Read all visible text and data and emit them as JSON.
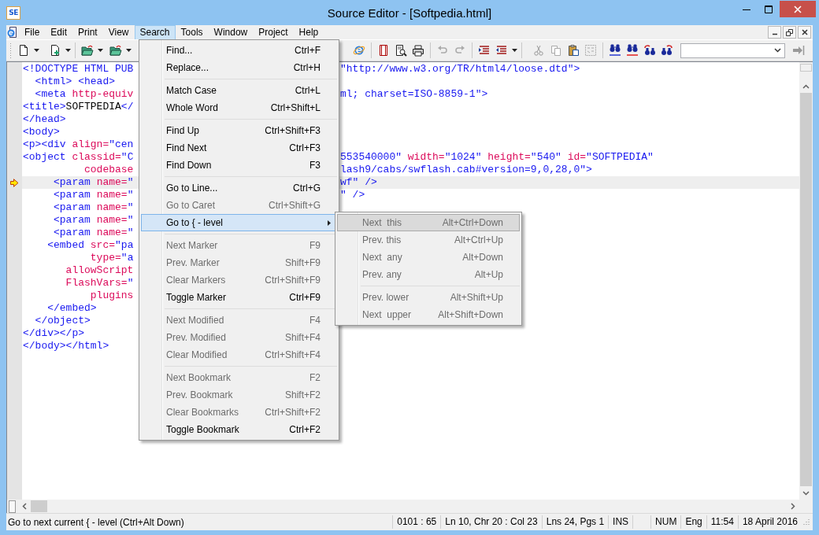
{
  "window": {
    "title": "Source Editor - [Softpedia.html]",
    "app_badge": "SE"
  },
  "menubar": [
    {
      "label": "File",
      "selected": false
    },
    {
      "label": "Edit",
      "selected": false
    },
    {
      "label": "Print",
      "selected": false
    },
    {
      "label": "View",
      "selected": false
    },
    {
      "label": "Search",
      "selected": true
    },
    {
      "label": "Tools",
      "selected": false
    },
    {
      "label": "Window",
      "selected": false
    },
    {
      "label": "Project",
      "selected": false
    },
    {
      "label": "Help",
      "selected": false
    }
  ],
  "editor": {
    "lines": [
      {
        "current": false,
        "marker": false,
        "left": [
          {
            "kind": "tag",
            "text": "<!DOCTYPE HTML PUB"
          }
        ],
        "right": [
          {
            "kind": "tag",
            "text": "\"http://www.w3.org/TR/html4/loose.dtd\">"
          }
        ]
      },
      {
        "current": false,
        "marker": false,
        "left": [
          {
            "kind": "tag",
            "text": "  <html> <head>"
          }
        ]
      },
      {
        "current": false,
        "marker": false,
        "left": [
          {
            "kind": "tag",
            "text": "  <meta"
          },
          {
            "kind": "attr",
            "text": " http-equiv"
          }
        ],
        "right": [
          {
            "kind": "tag",
            "text": "ml; charset=ISO-8859-1\">"
          }
        ]
      },
      {
        "current": false,
        "marker": false,
        "left": [
          {
            "kind": "tag",
            "text": "<title>"
          },
          {
            "kind": "text",
            "text": "SOFTPEDIA"
          },
          {
            "kind": "tag",
            "text": "</"
          }
        ]
      },
      {
        "current": false,
        "marker": false,
        "left": [
          {
            "kind": "tag",
            "text": "</head>"
          }
        ]
      },
      {
        "current": false,
        "marker": false,
        "left": [
          {
            "kind": "tag",
            "text": "<body>"
          }
        ]
      },
      {
        "current": false,
        "marker": false,
        "left": [
          {
            "kind": "tag",
            "text": "<p><div"
          },
          {
            "kind": "attr",
            "text": " align="
          },
          {
            "kind": "tag",
            "text": "\"cen"
          }
        ]
      },
      {
        "current": false,
        "marker": false,
        "left": [
          {
            "kind": "tag",
            "text": "<object"
          },
          {
            "kind": "attr",
            "text": " classid="
          },
          {
            "kind": "tag",
            "text": "\"C"
          }
        ],
        "right": [
          {
            "kind": "tag",
            "text": "553540000\""
          },
          {
            "kind": "attr",
            "text": " width="
          },
          {
            "kind": "tag",
            "text": "\"1024\""
          },
          {
            "kind": "attr",
            "text": " height="
          },
          {
            "kind": "tag",
            "text": "\"540\""
          },
          {
            "kind": "attr",
            "text": " id="
          },
          {
            "kind": "tag",
            "text": "\"SOFTPEDIA\""
          }
        ]
      },
      {
        "current": false,
        "marker": false,
        "left": [
          {
            "kind": "attr",
            "text": "          codebase"
          }
        ],
        "right": [
          {
            "kind": "tag",
            "text": "lash9/cabs/swflash.cab#version=9,0,28,0\">"
          }
        ]
      },
      {
        "current": true,
        "marker": true,
        "left": [
          {
            "kind": "tag",
            "text": "     <param"
          },
          {
            "kind": "attr",
            "text": " name="
          },
          {
            "kind": "tag",
            "text": "\""
          }
        ],
        "right": [
          {
            "kind": "tag",
            "text": "wf\" />"
          }
        ]
      },
      {
        "current": false,
        "marker": false,
        "left": [
          {
            "kind": "tag",
            "text": "     <param"
          },
          {
            "kind": "attr",
            "text": " name="
          },
          {
            "kind": "tag",
            "text": "\""
          }
        ],
        "right": [
          {
            "kind": "tag",
            "text": "\" />"
          }
        ]
      },
      {
        "current": false,
        "marker": false,
        "left": [
          {
            "kind": "tag",
            "text": "     <param"
          },
          {
            "kind": "attr",
            "text": " name="
          },
          {
            "kind": "tag",
            "text": "\""
          }
        ]
      },
      {
        "current": false,
        "marker": false,
        "left": [
          {
            "kind": "tag",
            "text": "     <param"
          },
          {
            "kind": "attr",
            "text": " name="
          },
          {
            "kind": "tag",
            "text": "\""
          }
        ]
      },
      {
        "current": false,
        "marker": false,
        "left": [
          {
            "kind": "tag",
            "text": "     <param"
          },
          {
            "kind": "attr",
            "text": " name="
          },
          {
            "kind": "tag",
            "text": "\""
          }
        ]
      },
      {
        "current": false,
        "marker": false,
        "left": [
          {
            "kind": "tag",
            "text": "    <embed"
          },
          {
            "kind": "attr",
            "text": " src="
          },
          {
            "kind": "tag",
            "text": "\"pa"
          }
        ]
      },
      {
        "current": false,
        "marker": false,
        "left": [
          {
            "kind": "attr",
            "text": "           type="
          },
          {
            "kind": "tag",
            "text": "\"a"
          }
        ]
      },
      {
        "current": false,
        "marker": false,
        "left": [
          {
            "kind": "attr",
            "text": "       allowScript"
          }
        ]
      },
      {
        "current": false,
        "marker": false,
        "left": [
          {
            "kind": "attr",
            "text": "       FlashVars="
          },
          {
            "kind": "tag",
            "text": "\""
          }
        ]
      },
      {
        "current": false,
        "marker": false,
        "left": [
          {
            "kind": "attr",
            "text": "           plugins"
          }
        ]
      },
      {
        "current": false,
        "marker": false,
        "left": [
          {
            "kind": "tag",
            "text": "    </embed>"
          }
        ]
      },
      {
        "current": false,
        "marker": false,
        "left": [
          {
            "kind": "tag",
            "text": "  </object>"
          }
        ]
      },
      {
        "current": false,
        "marker": false,
        "left": [
          {
            "kind": "tag",
            "text": "</div></p>"
          }
        ]
      },
      {
        "current": false,
        "marker": false,
        "left": [
          {
            "kind": "tag",
            "text": "</body></html>"
          }
        ]
      }
    ]
  },
  "search_menu": {
    "groups": [
      [
        {
          "label": "Find...",
          "shortcut": "Ctrl+F",
          "disabled": false,
          "selected": false
        },
        {
          "label": "Replace...",
          "shortcut": "Ctrl+H",
          "disabled": false,
          "selected": false
        }
      ],
      [
        {
          "label": "Match Case",
          "shortcut": "Ctrl+L",
          "disabled": false,
          "selected": false
        },
        {
          "label": "Whole Word",
          "shortcut": "Ctrl+Shift+L",
          "disabled": false,
          "selected": false
        }
      ],
      [
        {
          "label": "Find Up",
          "shortcut": "Ctrl+Shift+F3",
          "disabled": false,
          "selected": false
        },
        {
          "label": "Find Next",
          "shortcut": "Ctrl+F3",
          "disabled": false,
          "selected": false
        },
        {
          "label": "Find Down",
          "shortcut": "F3",
          "disabled": false,
          "selected": false
        }
      ],
      [
        {
          "label": "Go to Line...",
          "shortcut": "Ctrl+G",
          "disabled": false,
          "selected": false
        },
        {
          "label": "Go to Caret",
          "shortcut": "Ctrl+Shift+G",
          "disabled": true,
          "selected": false
        },
        {
          "label": "Go to { - level",
          "disabled": false,
          "selected": true,
          "submenu": {
            "groups": [
              [
                {
                  "label": "Next  this",
                  "shortcut": "Alt+Ctrl+Down",
                  "disabled": true,
                  "selected": true
                },
                {
                  "label": "Prev. this",
                  "shortcut": "Alt+Ctrl+Up",
                  "disabled": true,
                  "selected": false
                },
                {
                  "label": "Next  any",
                  "shortcut": "Alt+Down",
                  "disabled": true,
                  "selected": false
                },
                {
                  "label": "Prev. any",
                  "shortcut": "Alt+Up",
                  "disabled": true,
                  "selected": false
                }
              ],
              [
                {
                  "label": "Prev. lower",
                  "shortcut": "Alt+Shift+Up",
                  "disabled": true,
                  "selected": false
                },
                {
                  "label": "Next  upper",
                  "shortcut": "Alt+Shift+Down",
                  "disabled": true,
                  "selected": false
                }
              ]
            ]
          }
        }
      ],
      [
        {
          "label": "Next Marker",
          "shortcut": "F9",
          "disabled": true,
          "selected": false
        },
        {
          "label": "Prev. Marker",
          "shortcut": "Shift+F9",
          "disabled": true,
          "selected": false
        },
        {
          "label": "Clear Markers",
          "shortcut": "Ctrl+Shift+F9",
          "disabled": true,
          "selected": false
        },
        {
          "label": "Toggle Marker",
          "shortcut": "Ctrl+F9",
          "disabled": false,
          "selected": false
        }
      ],
      [
        {
          "label": "Next Modified",
          "shortcut": "F4",
          "disabled": true,
          "selected": false
        },
        {
          "label": "Prev. Modified",
          "shortcut": "Shift+F4",
          "disabled": true,
          "selected": false
        },
        {
          "label": "Clear Modified",
          "shortcut": "Ctrl+Shift+F4",
          "disabled": true,
          "selected": false
        }
      ],
      [
        {
          "label": "Next Bookmark",
          "shortcut": "F2",
          "disabled": true,
          "selected": false
        },
        {
          "label": "Prev. Bookmark",
          "shortcut": "Shift+F2",
          "disabled": true,
          "selected": false
        },
        {
          "label": "Clear Bookmarks",
          "shortcut": "Ctrl+Shift+F2",
          "disabled": true,
          "selected": false
        },
        {
          "label": "Toggle Bookmark",
          "shortcut": "Ctrl+F2",
          "disabled": false,
          "selected": false
        }
      ]
    ]
  },
  "status_bar": {
    "message": "Go to next current { - level (Ctrl+Alt Down)",
    "panels": [
      "0101 : 65",
      "Ln 10, Chr 20 : Col 23",
      "Lns 24, Pgs 1",
      "INS",
      "NUM",
      "Eng",
      "11:54",
      "18 April 2016"
    ]
  }
}
